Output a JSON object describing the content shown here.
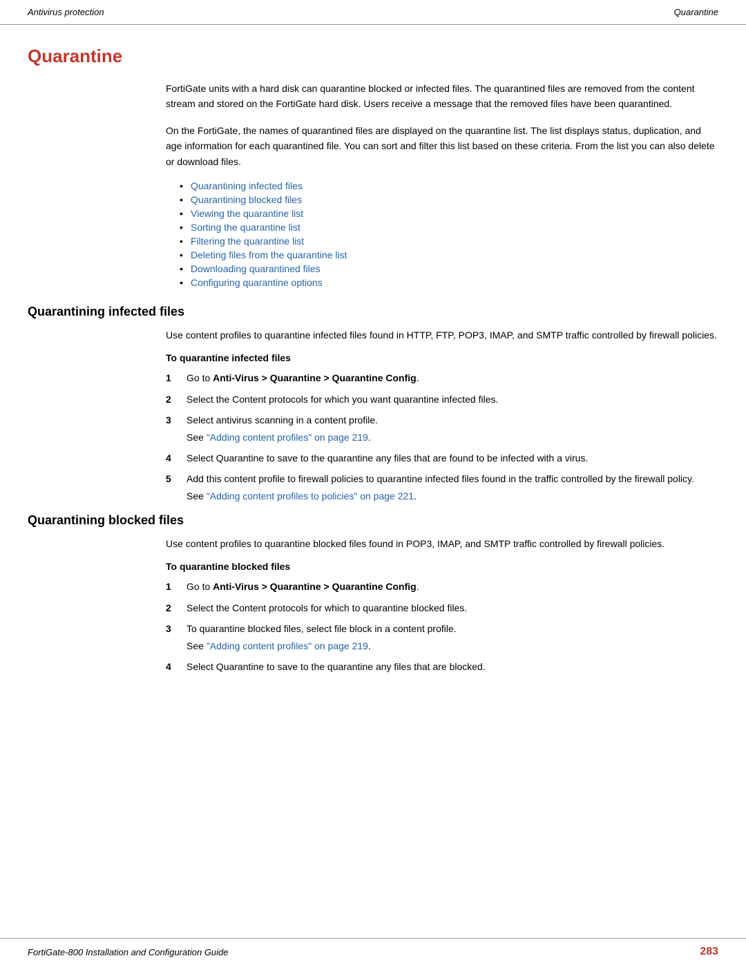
{
  "header": {
    "left": "Antivirus protection",
    "right": "Quarantine"
  },
  "page_title": "Quarantine",
  "intro_paragraphs": [
    "FortiGate units with a hard disk can quarantine blocked or infected files. The quarantined files are removed from the content stream and stored on the FortiGate hard disk. Users receive a message that the removed files have been quarantined.",
    "On the FortiGate, the names of quarantined files are displayed on the quarantine list. The list displays status, duplication, and age information for each quarantined file. You can sort and filter this list based on these criteria. From the list you can also delete or download files."
  ],
  "toc_items": [
    {
      "label": "Quarantining infected files",
      "href": "#quarantining-infected"
    },
    {
      "label": "Quarantining blocked files",
      "href": "#quarantining-blocked"
    },
    {
      "label": "Viewing the quarantine list",
      "href": "#viewing"
    },
    {
      "label": "Sorting the quarantine list",
      "href": "#sorting"
    },
    {
      "label": "Filtering the quarantine list",
      "href": "#filtering"
    },
    {
      "label": "Deleting files from the quarantine list",
      "href": "#deleting"
    },
    {
      "label": "Downloading quarantined files",
      "href": "#downloading"
    },
    {
      "label": "Configuring quarantine options",
      "href": "#configuring"
    }
  ],
  "sections": [
    {
      "id": "quarantining-infected",
      "heading": "Quarantining infected files",
      "intro": "Use content profiles to quarantine infected files found in HTTP, FTP, POP3, IMAP, and SMTP traffic controlled by firewall policies.",
      "sub_heading": "To quarantine infected files",
      "steps": [
        {
          "num": "1",
          "text": "Go to ",
          "bold": "Anti-Virus > Quarantine > Quarantine Config",
          "text_after": ".",
          "link_text": null,
          "link_href": null,
          "sub_text": null
        },
        {
          "num": "2",
          "text": "Select the Content protocols for which you want quarantine infected files.",
          "bold": null,
          "text_after": null,
          "link_text": null,
          "link_href": null,
          "sub_text": null
        },
        {
          "num": "3",
          "text": "Select antivirus scanning in a content profile.",
          "bold": null,
          "text_after": null,
          "link_text": "Adding content profiles\" on page 219",
          "link_href": "#",
          "sub_text": "See "
        },
        {
          "num": "4",
          "text": "Select Quarantine to save to the quarantine any files that are found to be infected with a virus.",
          "bold": null,
          "text_after": null,
          "link_text": null,
          "link_href": null,
          "sub_text": null
        },
        {
          "num": "5",
          "text": "Add this content profile to firewall policies to quarantine infected files found in the traffic controlled by the firewall policy.",
          "bold": null,
          "text_after": null,
          "link_text": "Adding content profiles to policies\" on page 221",
          "link_href": "#",
          "sub_text": "See "
        }
      ]
    },
    {
      "id": "quarantining-blocked",
      "heading": "Quarantining blocked files",
      "intro": "Use content profiles to quarantine blocked files found in POP3, IMAP, and SMTP traffic controlled by firewall policies.",
      "sub_heading": "To quarantine blocked files",
      "steps": [
        {
          "num": "1",
          "text": "Go to ",
          "bold": "Anti-Virus > Quarantine > Quarantine Config",
          "text_after": ".",
          "link_text": null,
          "link_href": null,
          "sub_text": null
        },
        {
          "num": "2",
          "text": "Select the Content protocols for which to quarantine blocked files.",
          "bold": null,
          "text_after": null,
          "link_text": null,
          "link_href": null,
          "sub_text": null
        },
        {
          "num": "3",
          "text": "To quarantine blocked files, select file block in a content profile.",
          "bold": null,
          "text_after": null,
          "link_text": "Adding content profiles\" on page 219",
          "link_href": "#",
          "sub_text": "See "
        },
        {
          "num": "4",
          "text": "Select Quarantine to save to the quarantine any files that are blocked.",
          "bold": null,
          "text_after": null,
          "link_text": null,
          "link_href": null,
          "sub_text": null
        }
      ]
    }
  ],
  "footer": {
    "left": "FortiGate-800 Installation and Configuration Guide",
    "right": "283"
  }
}
